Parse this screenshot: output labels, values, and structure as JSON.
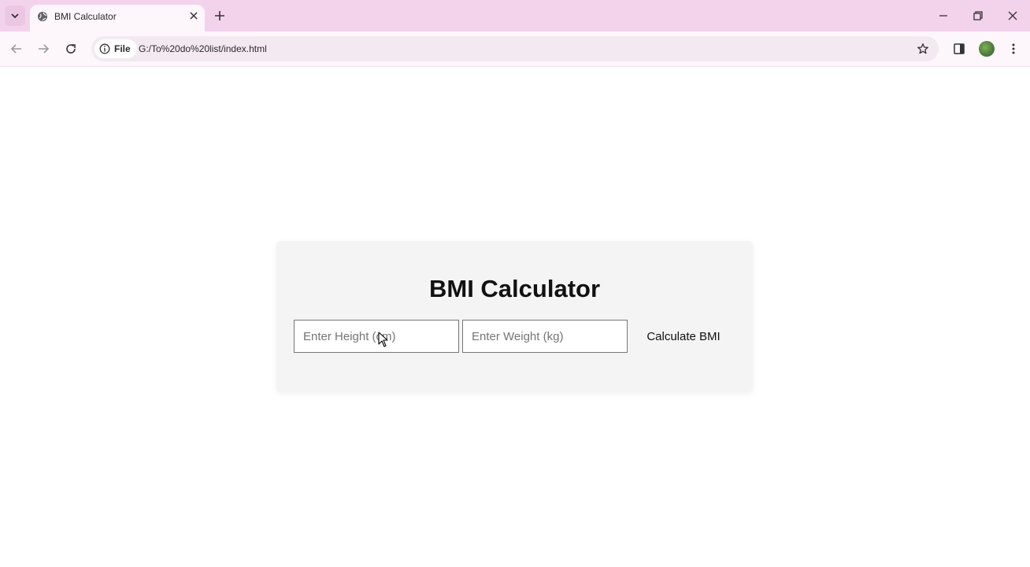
{
  "browser": {
    "tab_title": "BMI Calculator",
    "site_chip_label": "File",
    "url": "G:/To%20do%20list/index.html"
  },
  "page": {
    "heading": "BMI Calculator",
    "height_placeholder": "Enter Height (cm)",
    "weight_placeholder": "Enter Weight (kg)",
    "calculate_label": "Calculate BMI"
  },
  "colors": {
    "tabstrip": "#f3d3ec",
    "toolbar": "#fdf6fb",
    "card": "#f4f4f4"
  }
}
